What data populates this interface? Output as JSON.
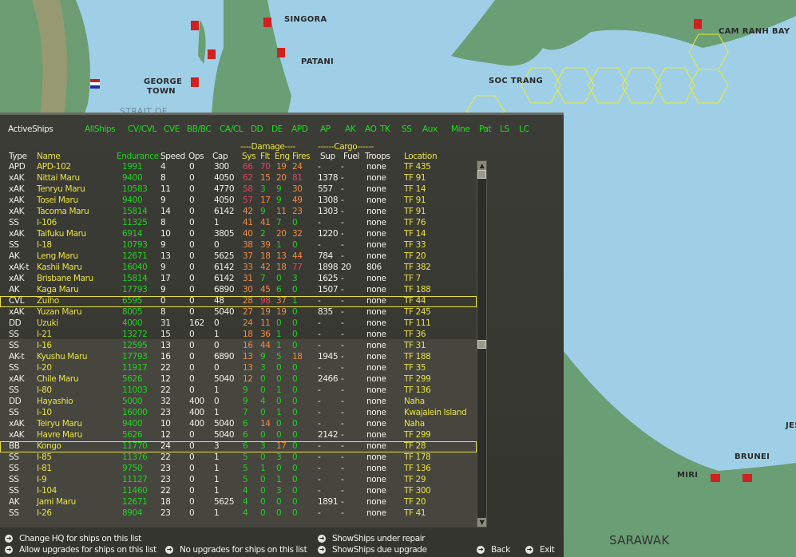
{
  "map": {
    "labels": [
      "SINGORA",
      "PATANI",
      "GEORGE TOWN",
      "STRAIT OF",
      "SOC TRANG",
      "CAM RANH BAY",
      "BRUNEI",
      "MIRI",
      "SARAWAK",
      "JES"
    ]
  },
  "panel": {
    "title": "ActiveShips",
    "filters": [
      "AllShips",
      "CV/CVL",
      "CVE",
      "BB/BC",
      "CA/CL",
      "DD",
      "DE",
      "APD",
      "AP",
      "AK",
      "AO",
      "TK",
      "SS",
      "Aux",
      "Mine",
      "Pat",
      "LS",
      "LC"
    ],
    "group_headers": {
      "damage": "----Damage----",
      "cargo": "------Cargo------"
    },
    "columns": [
      "Type",
      "Name",
      "Endurance",
      "Speed",
      "Ops",
      "Cap",
      "Sys",
      "Flt",
      "Eng",
      "Fires",
      "Sup",
      "Fuel",
      "Troops",
      "Location"
    ],
    "rows": [
      [
        "APD",
        "APD-102",
        "1991",
        "4",
        "0",
        "300",
        "66",
        "70",
        "19",
        "24",
        "-",
        "-",
        "none",
        "TF 435"
      ],
      [
        "xAK",
        "Nittai Maru",
        "9400",
        "8",
        "0",
        "4050",
        "62",
        "15",
        "20",
        "81",
        "1378",
        "-",
        "none",
        "TF 91"
      ],
      [
        "xAK",
        "Tenryu Maru",
        "10583",
        "11",
        "0",
        "4770",
        "58",
        "3",
        "9",
        "30",
        "557",
        "-",
        "none",
        "TF 14"
      ],
      [
        "xAK",
        "Tosei Maru",
        "9400",
        "9",
        "0",
        "4050",
        "57",
        "17",
        "9",
        "49",
        "1308",
        "-",
        "none",
        "TF 91"
      ],
      [
        "xAK",
        "Tacoma Maru",
        "15814",
        "14",
        "0",
        "6142",
        "42",
        "9",
        "11",
        "23",
        "1303",
        "-",
        "none",
        "TF 91"
      ],
      [
        "SS",
        "I-106",
        "11325",
        "8",
        "0",
        "1",
        "41",
        "41",
        "7",
        "0",
        "-",
        "-",
        "none",
        "TF 76"
      ],
      [
        "xAK",
        "Taifuku Maru",
        "6914",
        "10",
        "0",
        "3805",
        "40",
        "2",
        "20",
        "32",
        "1220",
        "-",
        "none",
        "TF 14"
      ],
      [
        "SS",
        "I-18",
        "10793",
        "9",
        "0",
        "0",
        "38",
        "39",
        "1",
        "0",
        "-",
        "-",
        "none",
        "TF 33"
      ],
      [
        "AK",
        "Leng Maru",
        "12671",
        "13",
        "0",
        "5625",
        "37",
        "18",
        "13",
        "44",
        "784",
        "-",
        "none",
        "TF 20"
      ],
      [
        "xAK-t",
        "Kashii Maru",
        "16040",
        "9",
        "0",
        "6142",
        "33",
        "42",
        "18",
        "77",
        "1898",
        "20",
        "806",
        "TF 382"
      ],
      [
        "xAK",
        "Brisbane Maru",
        "15814",
        "17",
        "0",
        "6142",
        "31",
        "7",
        "0",
        "3",
        "1625",
        "-",
        "none",
        "TF 7"
      ],
      [
        "AK",
        "Kaga Maru",
        "17793",
        "9",
        "0",
        "6890",
        "30",
        "45",
        "6",
        "0",
        "1507",
        "-",
        "none",
        "TF 188"
      ],
      [
        "CVL",
        "Zuiho",
        "6595",
        "0",
        "0",
        "48",
        "28",
        "98",
        "37",
        "1",
        "-",
        "-",
        "none",
        "TF 44"
      ],
      [
        "xAK",
        "Yuzan Maru",
        "8005",
        "8",
        "0",
        "5040",
        "27",
        "19",
        "19",
        "0",
        "835",
        "-",
        "none",
        "TF 245"
      ],
      [
        "DD",
        "Uzuki",
        "4000",
        "31",
        "162",
        "0",
        "24",
        "11",
        "0",
        "0",
        "-",
        "-",
        "none",
        "TF 111"
      ],
      [
        "SS",
        "I-21",
        "13272",
        "15",
        "0",
        "1",
        "18",
        "36",
        "1",
        "0",
        "-",
        "-",
        "none",
        "TF 36"
      ],
      [
        "SS",
        "I-16",
        "12595",
        "13",
        "0",
        "0",
        "16",
        "44",
        "1",
        "0",
        "-",
        "-",
        "none",
        "TF 31"
      ],
      [
        "AK-t",
        "Kyushu Maru",
        "17793",
        "16",
        "0",
        "6890",
        "13",
        "9",
        "5",
        "18",
        "1945",
        "-",
        "none",
        "TF 188"
      ],
      [
        "SS",
        "I-20",
        "11917",
        "22",
        "0",
        "0",
        "13",
        "3",
        "0",
        "0",
        "-",
        "-",
        "none",
        "TF 35"
      ],
      [
        "xAK",
        "Chile Maru",
        "5626",
        "12",
        "0",
        "5040",
        "12",
        "0",
        "0",
        "0",
        "2466",
        "-",
        "none",
        "TF 299"
      ],
      [
        "SS",
        "I-80",
        "11003",
        "22",
        "0",
        "1",
        "9",
        "0",
        "1",
        "0",
        "-",
        "-",
        "none",
        "TF 136"
      ],
      [
        "DD",
        "Hayashio",
        "5000",
        "32",
        "400",
        "0",
        "9",
        "4",
        "0",
        "0",
        "-",
        "-",
        "none",
        "Naha"
      ],
      [
        "SS",
        "I-10",
        "16000",
        "23",
        "400",
        "1",
        "7",
        "0",
        "1",
        "0",
        "-",
        "-",
        "none",
        "Kwajalein Island"
      ],
      [
        "xAK",
        "Teiryu Maru",
        "9400",
        "10",
        "400",
        "5040",
        "6",
        "14",
        "0",
        "0",
        "-",
        "-",
        "none",
        "Naha"
      ],
      [
        "xAK",
        "Havre Maru",
        "5626",
        "12",
        "0",
        "5040",
        "6",
        "0",
        "0",
        "0",
        "2142",
        "-",
        "none",
        "TF 299"
      ],
      [
        "BB",
        "Kongo",
        "11770",
        "24",
        "0",
        "3",
        "6",
        "3",
        "17",
        "0",
        "-",
        "-",
        "none",
        "TF 28"
      ],
      [
        "SS",
        "I-85",
        "11376",
        "22",
        "0",
        "1",
        "5",
        "0",
        "3",
        "0",
        "-",
        "-",
        "none",
        "TF 178"
      ],
      [
        "SS",
        "I-81",
        "9750",
        "23",
        "0",
        "1",
        "5",
        "1",
        "0",
        "0",
        "-",
        "-",
        "none",
        "TF 136"
      ],
      [
        "SS",
        "I-9",
        "11127",
        "23",
        "0",
        "1",
        "5",
        "0",
        "1",
        "0",
        "-",
        "-",
        "none",
        "TF 29"
      ],
      [
        "SS",
        "I-104",
        "11460",
        "22",
        "0",
        "1",
        "4",
        "0",
        "3",
        "0",
        "-",
        "-",
        "none",
        "TF 300"
      ],
      [
        "AK",
        "Jami Maru",
        "12671",
        "18",
        "0",
        "5625",
        "4",
        "0",
        "0",
        "0",
        "1891",
        "-",
        "none",
        "TF 20"
      ],
      [
        "SS",
        "I-26",
        "8904",
        "23",
        "0",
        "1",
        "4",
        "0",
        "0",
        "0",
        "-",
        "-",
        "none",
        "TF 41"
      ]
    ],
    "selected_rows": [
      "Zuiho",
      "Kongo"
    ],
    "actions": {
      "change_hq": "Change HQ for ships on this list",
      "allow_upgrades": "Allow upgrades for ships on this list",
      "no_upgrades": "No upgrades for ships on this list",
      "show_repair": "ShowShips under repair",
      "show_upgrade": "ShowShips due upgrade",
      "back": "Back",
      "exit": "Exit"
    },
    "colors": {
      "high": "#e04060",
      "mid": "#f08a40",
      "low": "#22d022",
      "accent": "#e8e040",
      "filter": "#19e019"
    }
  }
}
